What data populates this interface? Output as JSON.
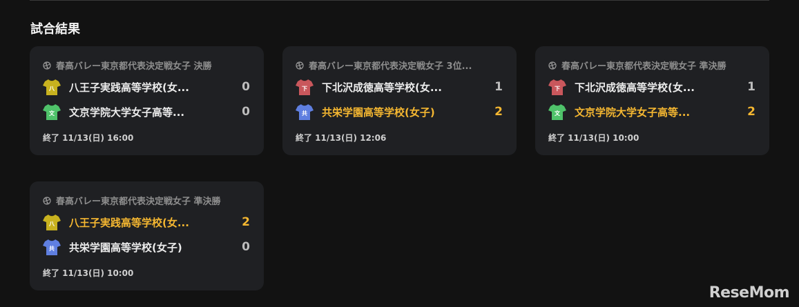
{
  "section_title": "試合結果",
  "colors": {
    "accent_win": "#f5b731",
    "card_bg": "#1f2023"
  },
  "matches": [
    {
      "event": "春高バレー東京都代表決定戦女子 決勝",
      "status": "終了 11/13(日) 16:00",
      "teams": [
        {
          "name": "八王子実践高等学校(女...",
          "score": "0",
          "shirt_label": "八",
          "shirt_color": "#c8b21f",
          "winner": false
        },
        {
          "name": "文京学院大学女子高等...",
          "score": "0",
          "shirt_label": "文",
          "shirt_color": "#4fc26a",
          "winner": false
        }
      ]
    },
    {
      "event": "春高バレー東京都代表決定戦女子 3位...",
      "status": "終了 11/13(日) 12:06",
      "teams": [
        {
          "name": "下北沢成徳高等学校(女...",
          "score": "1",
          "shirt_label": "下",
          "shirt_color": "#c9575c",
          "winner": false
        },
        {
          "name": "共栄学園高等学校(女子)",
          "score": "2",
          "shirt_label": "共",
          "shirt_color": "#5f7fe0",
          "winner": true
        }
      ]
    },
    {
      "event": "春高バレー東京都代表決定戦女子 準決勝",
      "status": "終了 11/13(日) 10:00",
      "teams": [
        {
          "name": "下北沢成徳高等学校(女...",
          "score": "1",
          "shirt_label": "下",
          "shirt_color": "#c9575c",
          "winner": false
        },
        {
          "name": "文京学院大学女子高等...",
          "score": "2",
          "shirt_label": "文",
          "shirt_color": "#4fc26a",
          "winner": true
        }
      ]
    },
    {
      "event": "春高バレー東京都代表決定戦女子 準決勝",
      "status": "終了 11/13(日) 10:00",
      "teams": [
        {
          "name": "八王子実践高等学校(女...",
          "score": "2",
          "shirt_label": "八",
          "shirt_color": "#c8b21f",
          "winner": true
        },
        {
          "name": "共栄学園高等学校(女子)",
          "score": "0",
          "shirt_label": "共",
          "shirt_color": "#5f7fe0",
          "winner": false
        }
      ]
    }
  ],
  "watermark": "ReseMom"
}
